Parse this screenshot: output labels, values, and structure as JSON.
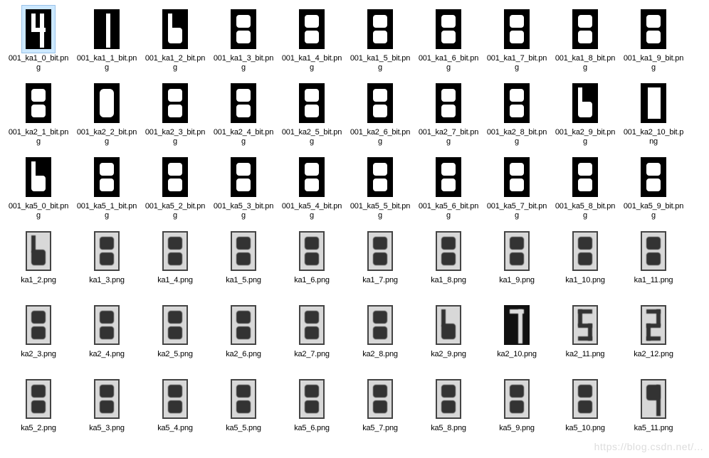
{
  "grid": {
    "rows": [
      {
        "items": [
          {
            "digit": "4",
            "style": "binary",
            "selected": true,
            "name": "001_ka1_0_bit.png"
          },
          {
            "digit": "1",
            "style": "binary",
            "name": "001_ka1_1_bit.png"
          },
          {
            "digit": "6",
            "style": "binary",
            "name": "001_ka1_2_bit.png"
          },
          {
            "digit": "8",
            "style": "binary",
            "name": "001_ka1_3_bit.png"
          },
          {
            "digit": "8",
            "style": "binary",
            "name": "001_ka1_4_bit.png"
          },
          {
            "digit": "8",
            "style": "binary",
            "name": "001_ka1_5_bit.png"
          },
          {
            "digit": "8",
            "style": "binary",
            "name": "001_ka1_6_bit.png"
          },
          {
            "digit": "8",
            "style": "binary",
            "name": "001_ka1_7_bit.png"
          },
          {
            "digit": "8",
            "style": "binary",
            "name": "001_ka1_8_bit.png"
          },
          {
            "digit": "8",
            "style": "binary",
            "name": "001_ka1_9_bit.png"
          }
        ]
      },
      {
        "items": [
          {
            "digit": "8",
            "style": "binary",
            "name": "001_ka2_1_bit.png"
          },
          {
            "digit": "0",
            "style": "binary",
            "name": "001_ka2_2_bit.png"
          },
          {
            "digit": "8",
            "style": "binary",
            "name": "001_ka2_3_bit.png"
          },
          {
            "digit": "8",
            "style": "binary",
            "name": "001_ka2_4_bit.png"
          },
          {
            "digit": "8",
            "style": "binary",
            "name": "001_ka2_5_bit.png"
          },
          {
            "digit": "8",
            "style": "binary",
            "name": "001_ka2_6_bit.png"
          },
          {
            "digit": "8",
            "style": "binary",
            "name": "001_ka2_7_bit.png"
          },
          {
            "digit": "8",
            "style": "binary",
            "name": "001_ka2_8_bit.png"
          },
          {
            "digit": "6",
            "style": "binary",
            "name": "001_ka2_9_bit.png"
          },
          {
            "digit": "bar",
            "style": "binary",
            "name": "001_ka2_10_bit.png"
          }
        ]
      },
      {
        "items": [
          {
            "digit": "6",
            "style": "binary",
            "name": "001_ka5_0_bit.png"
          },
          {
            "digit": "8",
            "style": "binary",
            "name": "001_ka5_1_bit.png"
          },
          {
            "digit": "8",
            "style": "binary",
            "name": "001_ka5_2_bit.png"
          },
          {
            "digit": "8",
            "style": "binary",
            "name": "001_ka5_3_bit.png"
          },
          {
            "digit": "8",
            "style": "binary",
            "name": "001_ka5_4_bit.png"
          },
          {
            "digit": "8",
            "style": "binary",
            "name": "001_ka5_5_bit.png"
          },
          {
            "digit": "8",
            "style": "binary",
            "name": "001_ka5_6_bit.png"
          },
          {
            "digit": "8",
            "style": "binary",
            "name": "001_ka5_7_bit.png"
          },
          {
            "digit": "8",
            "style": "binary",
            "name": "001_ka5_8_bit.png"
          },
          {
            "digit": "8",
            "style": "binary",
            "name": "001_ka5_9_bit.png"
          }
        ]
      },
      {
        "items": [
          {
            "digit": "6",
            "style": "gray",
            "name": "ka1_2.png"
          },
          {
            "digit": "8",
            "style": "gray",
            "name": "ka1_3.png"
          },
          {
            "digit": "8",
            "style": "gray",
            "name": "ka1_4.png"
          },
          {
            "digit": "8",
            "style": "gray",
            "name": "ka1_5.png"
          },
          {
            "digit": "8",
            "style": "gray",
            "name": "ka1_6.png"
          },
          {
            "digit": "8",
            "style": "gray",
            "name": "ka1_7.png"
          },
          {
            "digit": "8",
            "style": "gray",
            "name": "ka1_8.png"
          },
          {
            "digit": "8",
            "style": "gray",
            "name": "ka1_9.png"
          },
          {
            "digit": "8",
            "style": "gray",
            "name": "ka1_10.png"
          },
          {
            "digit": "8",
            "style": "gray",
            "name": "ka1_11.png"
          }
        ]
      },
      {
        "items": [
          {
            "digit": "8",
            "style": "gray",
            "name": "ka2_3.png"
          },
          {
            "digit": "8",
            "style": "gray",
            "name": "ka2_4.png"
          },
          {
            "digit": "8",
            "style": "gray",
            "name": "ka2_5.png"
          },
          {
            "digit": "8",
            "style": "gray",
            "name": "ka2_6.png"
          },
          {
            "digit": "8",
            "style": "gray",
            "name": "ka2_7.png"
          },
          {
            "digit": "8",
            "style": "gray",
            "name": "ka2_8.png"
          },
          {
            "digit": "6",
            "style": "gray",
            "name": "ka2_9.png"
          },
          {
            "digit": "7",
            "style": "dark",
            "name": "ka2_10.png"
          },
          {
            "digit": "5",
            "style": "gray",
            "name": "ka2_11.png"
          },
          {
            "digit": "2",
            "style": "gray",
            "name": "ka2_12.png"
          }
        ]
      },
      {
        "items": [
          {
            "digit": "8",
            "style": "gray",
            "name": "ka5_2.png"
          },
          {
            "digit": "8",
            "style": "gray",
            "name": "ka5_3.png"
          },
          {
            "digit": "8",
            "style": "gray",
            "name": "ka5_4.png"
          },
          {
            "digit": "8",
            "style": "gray",
            "name": "ka5_5.png"
          },
          {
            "digit": "8",
            "style": "gray",
            "name": "ka5_6.png"
          },
          {
            "digit": "8",
            "style": "gray",
            "name": "ka5_7.png"
          },
          {
            "digit": "8",
            "style": "gray",
            "name": "ka5_8.png"
          },
          {
            "digit": "8",
            "style": "gray",
            "name": "ka5_9.png"
          },
          {
            "digit": "8",
            "style": "gray",
            "name": "ka5_10.png"
          },
          {
            "digit": "9",
            "style": "gray",
            "name": "ka5_11.png"
          }
        ]
      }
    ]
  },
  "watermark": "https://blog.csdn.net/..."
}
